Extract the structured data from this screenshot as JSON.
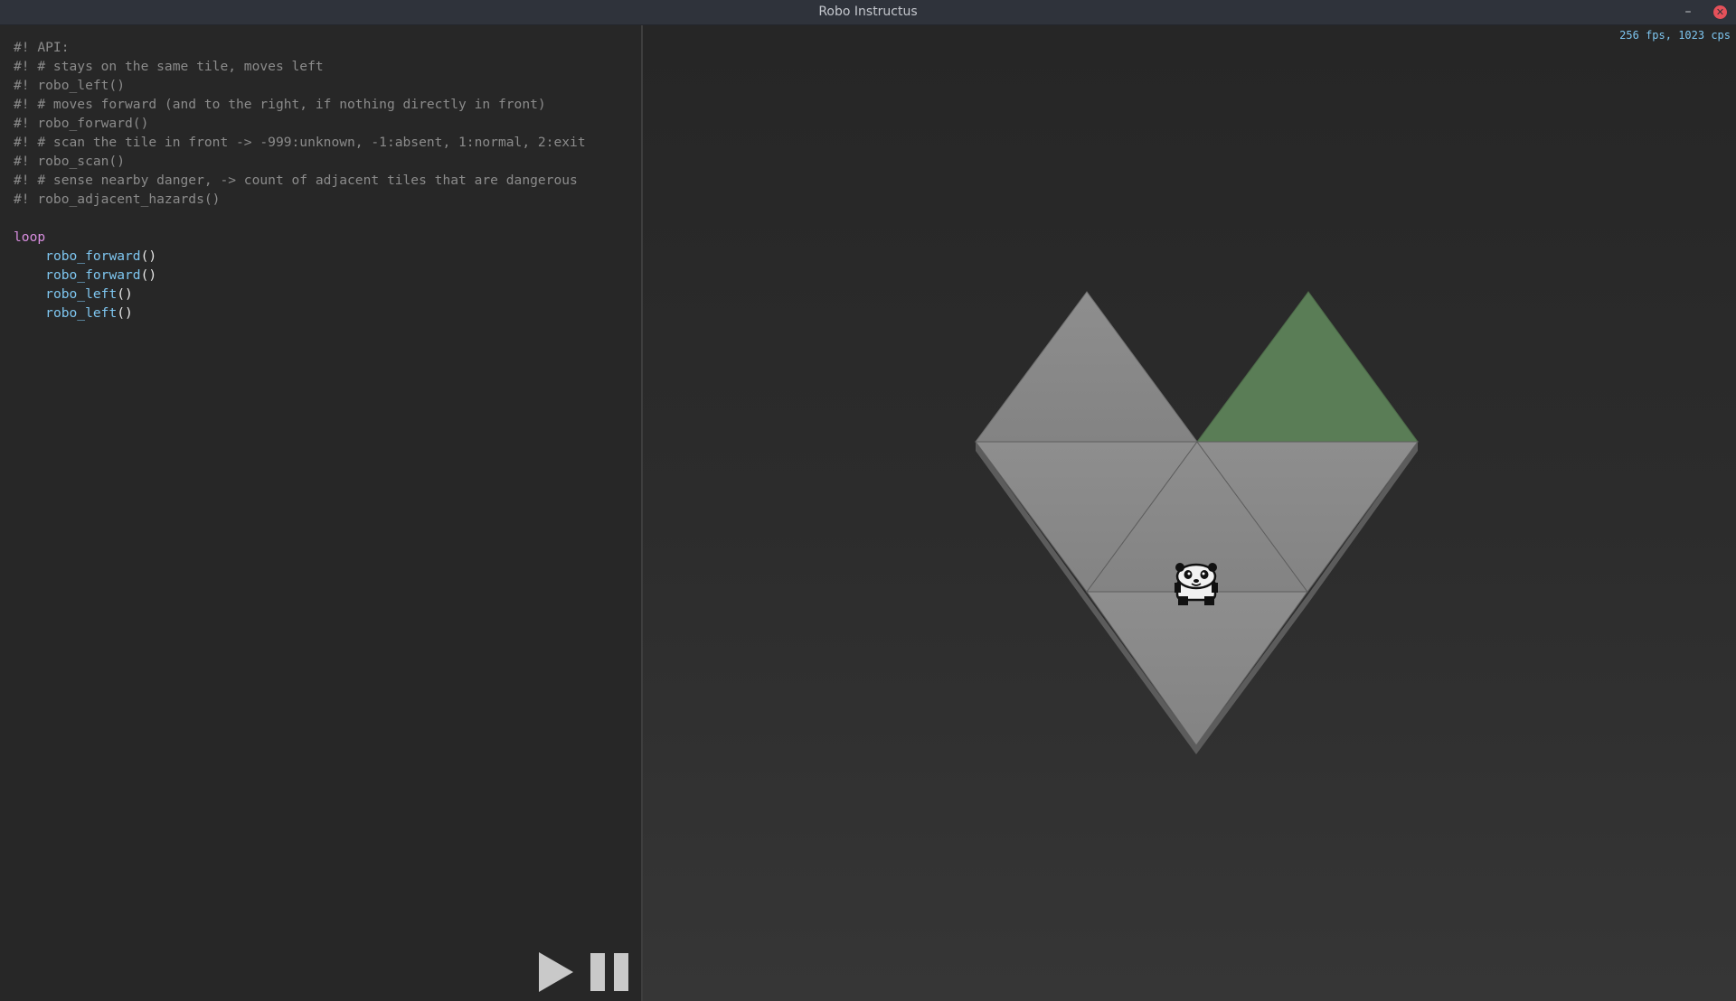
{
  "window": {
    "title": "Robo Instructus",
    "minimize_label": "–",
    "close_label": "✕"
  },
  "editor": {
    "comments": [
      "#! API:",
      "#! # stays on the same tile, moves left",
      "#! robo_left()",
      "#! # moves forward (and to the right, if nothing directly in front)",
      "#! robo_forward()",
      "#! # scan the tile in front -> -999:unknown, -1:absent, 1:normal, 2:exit",
      "#! robo_scan()",
      "#! # sense nearby danger, -> count of adjacent tiles that are dangerous",
      "#! robo_adjacent_hazards()"
    ],
    "loop_keyword": "loop",
    "body": [
      {
        "fn": "robo_forward",
        "args": "()"
      },
      {
        "fn": "robo_forward",
        "args": "()"
      },
      {
        "fn": "robo_left",
        "args": "()"
      },
      {
        "fn": "robo_left",
        "args": "()"
      }
    ]
  },
  "controls": {
    "play_icon": "play-icon",
    "pause_icon": "pause-icon"
  },
  "viewport": {
    "stats": "256 fps, 1023 cps",
    "tile_color": "#8a8a8a",
    "exit_tile_color": "#5a7d56",
    "robot": "panda-robot"
  }
}
